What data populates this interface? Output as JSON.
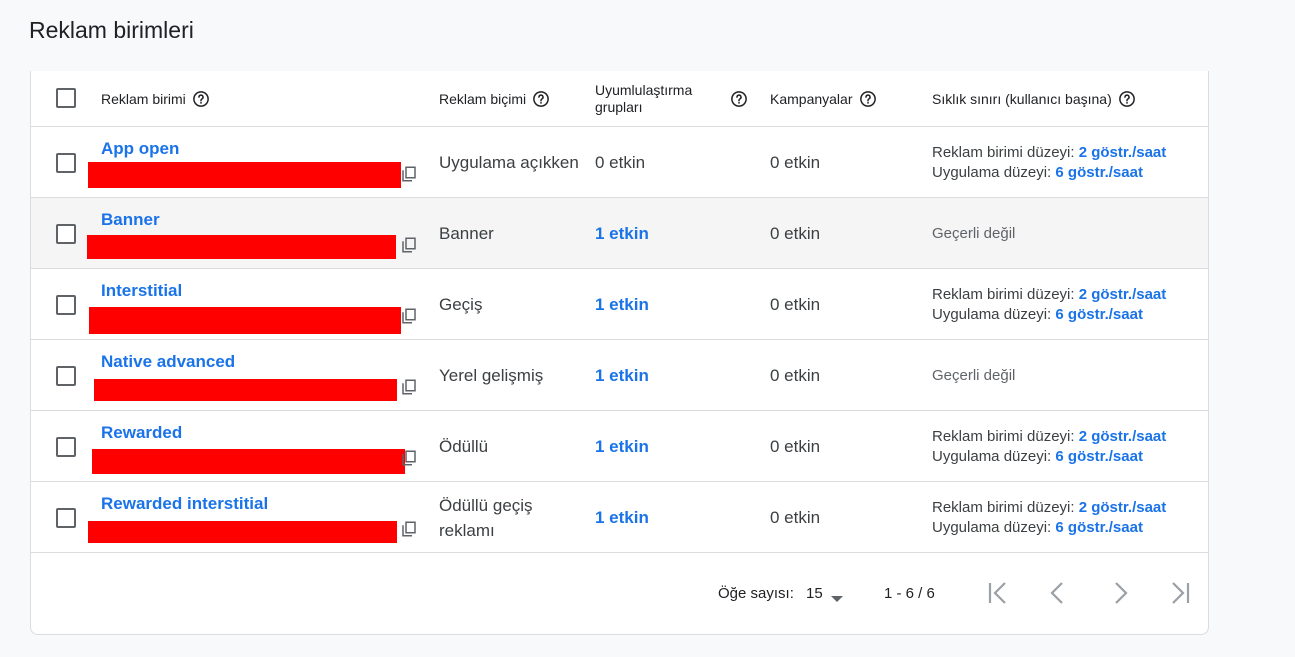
{
  "page": {
    "title": "Reklam birimleri"
  },
  "table": {
    "headers": {
      "unit": "Reklam birimi",
      "format": "Reklam biçimi",
      "mediation": "Uyumlulaştırma grupları",
      "campaigns": "Kampanyalar",
      "frequency": "Sıklık sınırı (kullanıcı başına)"
    },
    "rows": [
      {
        "name": "App open",
        "format": "Uygulama açıkken",
        "mediation": "0 etkin",
        "campaigns": "0 etkin",
        "freq_unit_label": "Reklam birimi düzeyi:",
        "freq_unit_value": "2 göstr./saat",
        "freq_app_label": "Uygulama düzeyi:",
        "freq_app_value": "6 göstr./saat"
      },
      {
        "name": "Banner",
        "format": "Banner",
        "mediation": "1 etkin",
        "campaigns": "0 etkin",
        "freq_na": "Geçerli değil"
      },
      {
        "name": "Interstitial",
        "format": "Geçiş",
        "mediation": "1 etkin",
        "campaigns": "0 etkin",
        "freq_unit_label": "Reklam birimi düzeyi:",
        "freq_unit_value": "2 göstr./saat",
        "freq_app_label": "Uygulama düzeyi:",
        "freq_app_value": "6 göstr./saat"
      },
      {
        "name": "Native advanced",
        "format": "Yerel gelişmiş",
        "mediation": "1 etkin",
        "campaigns": "0 etkin",
        "freq_na": "Geçerli değil"
      },
      {
        "name": "Rewarded",
        "format": "Ödüllü",
        "mediation": "1 etkin",
        "campaigns": "0 etkin",
        "freq_unit_label": "Reklam birimi düzeyi:",
        "freq_unit_value": "2 göstr./saat",
        "freq_app_label": "Uygulama düzeyi:",
        "freq_app_value": "6 göstr./saat"
      },
      {
        "name": "Rewarded interstitial",
        "format": "Ödüllü geçiş reklamı",
        "mediation": "1 etkin",
        "campaigns": "0 etkin",
        "freq_unit_label": "Reklam birimi düzeyi:",
        "freq_unit_value": "2 göstr./saat",
        "freq_app_label": "Uygulama düzeyi:",
        "freq_app_value": "6 göstr./saat"
      }
    ]
  },
  "pagination": {
    "per_page_label": "Öğe sayısı:",
    "per_page_value": "15",
    "range": "1 - 6 / 6"
  },
  "icons": {
    "help": "help-circle-icon",
    "copy": "copy-icon",
    "dropdown": "caret-down-icon",
    "first": "first-page-icon",
    "prev": "chevron-left-icon",
    "next": "chevron-right-icon",
    "last": "last-page-icon"
  },
  "colors": {
    "link": "#1a73e8",
    "redaction": "#ff0000",
    "hover_row": "#f5f5f5"
  }
}
